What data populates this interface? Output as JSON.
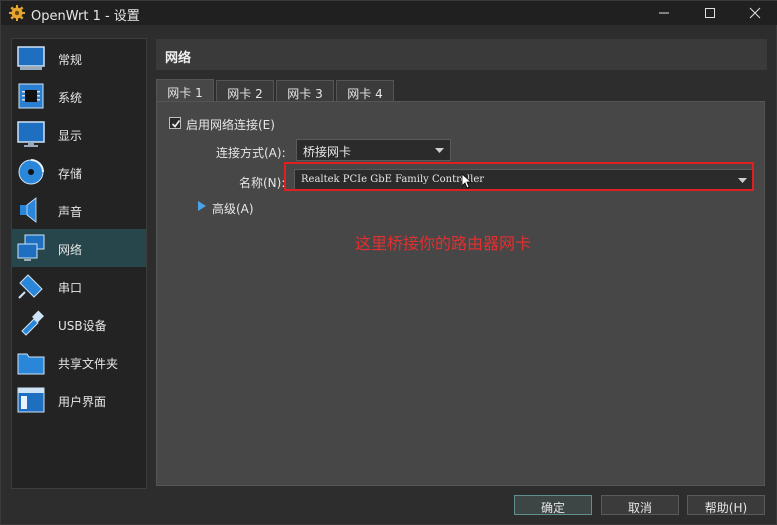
{
  "window": {
    "title": "OpenWrt 1 - 设置"
  },
  "sidebar": {
    "items": [
      {
        "label": "常规",
        "icon": "general-icon",
        "active": false
      },
      {
        "label": "系统",
        "icon": "chip-icon",
        "active": false
      },
      {
        "label": "显示",
        "icon": "monitor-icon",
        "active": false
      },
      {
        "label": "存储",
        "icon": "disk-icon",
        "active": false
      },
      {
        "label": "声音",
        "icon": "speaker-icon",
        "active": false
      },
      {
        "label": "网络",
        "icon": "network-icon",
        "active": true
      },
      {
        "label": "串口",
        "icon": "serial-port-icon",
        "active": false
      },
      {
        "label": "USB设备",
        "icon": "usb-icon",
        "active": false
      },
      {
        "label": "共享文件夹",
        "icon": "folder-icon",
        "active": false
      },
      {
        "label": "用户界面",
        "icon": "ui-window-icon",
        "active": false
      }
    ]
  },
  "page": {
    "title": "网络"
  },
  "tabs": [
    {
      "label": "网卡 1",
      "active": true
    },
    {
      "label": "网卡 2",
      "active": false
    },
    {
      "label": "网卡 3",
      "active": false
    },
    {
      "label": "网卡 4",
      "active": false
    }
  ],
  "adapter": {
    "enable_label": "启用网络连接(E)",
    "enabled": true,
    "attached_label": "连接方式(A):",
    "attached_value": "桥接网卡",
    "name_label": "名称(N):",
    "name_value": "Realtek PCIe GbE Family Controller",
    "advanced_label": "高级(A)"
  },
  "annotation": {
    "text": "这里桥接你的路由器网卡",
    "color": "#e03030"
  },
  "buttons": {
    "ok": "确定",
    "cancel": "取消",
    "help": "帮助(H)"
  },
  "colors": {
    "accent_active": "#26464b",
    "highlight_red": "#e02020"
  }
}
